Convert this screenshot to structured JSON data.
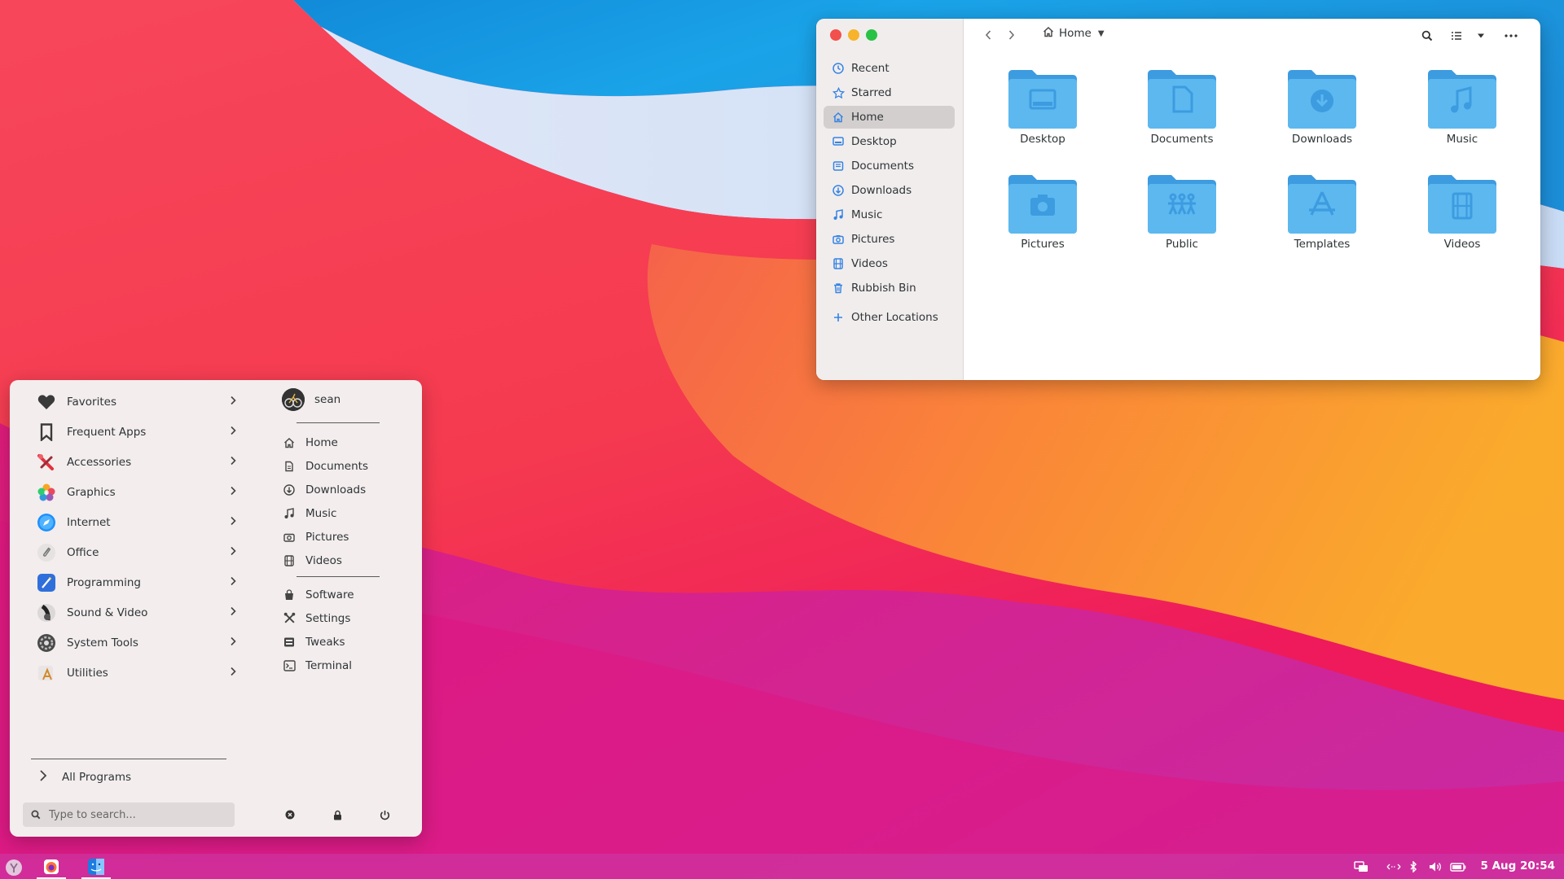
{
  "file_manager": {
    "location": "Home",
    "sidebar": [
      {
        "label": "Recent",
        "icon": "clock-icon"
      },
      {
        "label": "Starred",
        "icon": "star-icon"
      },
      {
        "label": "Home",
        "icon": "home-icon",
        "active": true
      },
      {
        "label": "Desktop",
        "icon": "desktop-icon"
      },
      {
        "label": "Documents",
        "icon": "document-icon"
      },
      {
        "label": "Downloads",
        "icon": "download-icon"
      },
      {
        "label": "Music",
        "icon": "music-icon"
      },
      {
        "label": "Pictures",
        "icon": "camera-icon"
      },
      {
        "label": "Videos",
        "icon": "film-icon"
      },
      {
        "label": "Rubbish Bin",
        "icon": "trash-icon"
      }
    ],
    "other_locations": "Other Locations",
    "folders": [
      {
        "label": "Desktop",
        "icon": "desktop-folder-icon"
      },
      {
        "label": "Documents",
        "icon": "documents-folder-icon"
      },
      {
        "label": "Downloads",
        "icon": "downloads-folder-icon"
      },
      {
        "label": "Music",
        "icon": "music-folder-icon"
      },
      {
        "label": "Pictures",
        "icon": "pictures-folder-icon"
      },
      {
        "label": "Public",
        "icon": "public-folder-icon"
      },
      {
        "label": "Templates",
        "icon": "templates-folder-icon"
      },
      {
        "label": "Videos",
        "icon": "videos-folder-icon"
      }
    ]
  },
  "app_menu": {
    "categories": [
      {
        "label": "Favorites",
        "icon": "heart-icon"
      },
      {
        "label": "Frequent Apps",
        "icon": "bookmark-icon"
      },
      {
        "label": "Accessories",
        "icon": "accessories-icon"
      },
      {
        "label": "Graphics",
        "icon": "graphics-icon"
      },
      {
        "label": "Internet",
        "icon": "internet-icon"
      },
      {
        "label": "Office",
        "icon": "office-icon"
      },
      {
        "label": "Programming",
        "icon": "programming-icon"
      },
      {
        "label": "Sound & Video",
        "icon": "speaker-icon"
      },
      {
        "label": "System Tools",
        "icon": "system-tools-icon"
      },
      {
        "label": "Utilities",
        "icon": "utilities-icon"
      }
    ],
    "all_programs": "All Programs",
    "search_placeholder": "Type to search...",
    "user": "sean",
    "places": [
      {
        "label": "Home",
        "icon": "home-icon"
      },
      {
        "label": "Documents",
        "icon": "document-icon"
      },
      {
        "label": "Downloads",
        "icon": "download-icon"
      },
      {
        "label": "Music",
        "icon": "music-icon"
      },
      {
        "label": "Pictures",
        "icon": "camera-icon"
      },
      {
        "label": "Videos",
        "icon": "film-icon"
      }
    ],
    "system": [
      {
        "label": "Software",
        "icon": "software-bag-icon"
      },
      {
        "label": "Settings",
        "icon": "settings-tools-icon"
      },
      {
        "label": "Tweaks",
        "icon": "tweaks-icon"
      },
      {
        "label": "Terminal",
        "icon": "terminal-icon"
      }
    ]
  },
  "panel": {
    "clock": "5 Aug 20:54"
  },
  "colors": {
    "folder": "#5db8ef",
    "folder_tab": "#3d9be0",
    "accent": "#3584e4"
  }
}
